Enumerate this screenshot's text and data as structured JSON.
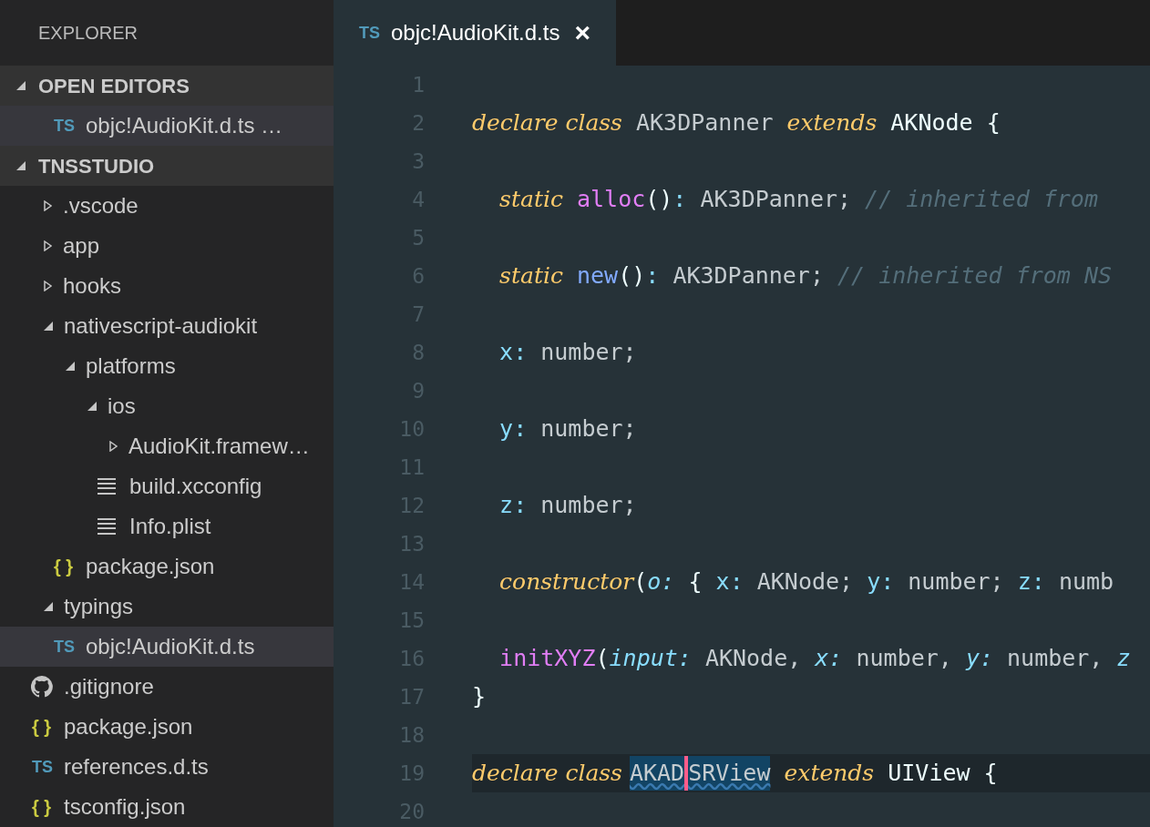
{
  "sidebar": {
    "title": "EXPLORER",
    "sections": [
      {
        "label": "OPEN EDITORS",
        "expanded": true,
        "items": [
          {
            "kind": "ts",
            "badge": "TS",
            "label": "objc!AudioKit.d.ts …",
            "selected": true
          }
        ]
      },
      {
        "label": "TNSSTUDIO",
        "expanded": true,
        "items": [
          {
            "kind": "folder",
            "label": ".vscode",
            "expanded": false,
            "selected": false
          },
          {
            "kind": "folder",
            "label": "app",
            "expanded": false,
            "selected": false
          },
          {
            "kind": "folder",
            "label": "hooks",
            "expanded": false,
            "selected": false
          },
          {
            "kind": "folder",
            "label": "nativescript-audiokit",
            "expanded": true,
            "selected": false,
            "children": [
              {
                "kind": "folder",
                "label": "platforms",
                "expanded": true,
                "selected": false,
                "children": [
                  {
                    "kind": "folder",
                    "label": "ios",
                    "expanded": true,
                    "selected": false,
                    "children": [
                      {
                        "kind": "folder",
                        "label": "AudioKit.framew…",
                        "expanded": false,
                        "selected": false
                      },
                      {
                        "kind": "text",
                        "label": "build.xcconfig",
                        "selected": false
                      },
                      {
                        "kind": "text",
                        "label": "Info.plist",
                        "selected": false
                      }
                    ]
                  }
                ]
              },
              {
                "kind": "json",
                "badge": "{ }",
                "label": "package.json",
                "selected": false
              }
            ]
          },
          {
            "kind": "folder",
            "label": "typings",
            "expanded": true,
            "selected": false,
            "children": [
              {
                "kind": "ts",
                "badge": "TS",
                "label": "objc!AudioKit.d.ts",
                "selected": true
              }
            ]
          },
          {
            "kind": "github",
            "label": ".gitignore",
            "selected": false
          },
          {
            "kind": "json",
            "badge": "{ }",
            "label": "package.json",
            "selected": false
          },
          {
            "kind": "ts",
            "badge": "TS",
            "label": "references.d.ts",
            "selected": false
          },
          {
            "kind": "json",
            "badge": "{ }",
            "label": "tsconfig.json",
            "selected": false
          }
        ]
      }
    ]
  },
  "tabs": [
    {
      "badge": "TS",
      "label": "objc!AudioKit.d.ts",
      "close": "×",
      "selected": true
    }
  ],
  "editor": {
    "lines": [
      {
        "n": "1"
      },
      {
        "n": "2",
        "tokens": [
          {
            "t": "declare class",
            "kind": "keyword"
          },
          {
            "t": " AK3DPanner ",
            "kind": "type"
          },
          {
            "t": "extends",
            "kind": "keyword"
          },
          {
            "t": " AKNode {",
            "kind": "plain"
          }
        ]
      },
      {
        "n": "3"
      },
      {
        "n": "4",
        "tokens": [
          {
            "t": "  static",
            "kind": "keyword"
          },
          {
            "t": " alloc",
            "kind": "method"
          },
          {
            "t": "()",
            "kind": "plain"
          },
          {
            "t": ":",
            "kind": "prop"
          },
          {
            "t": " AK3DPanner; ",
            "kind": "type"
          },
          {
            "t": "// inherited from",
            "kind": "comment"
          }
        ]
      },
      {
        "n": "5"
      },
      {
        "n": "6",
        "tokens": [
          {
            "t": "  static",
            "kind": "keyword"
          },
          {
            "t": " new",
            "kind": "ctor"
          },
          {
            "t": "()",
            "kind": "plain"
          },
          {
            "t": ":",
            "kind": "prop"
          },
          {
            "t": " AK3DPanner; ",
            "kind": "type"
          },
          {
            "t": "// inherited from NS",
            "kind": "comment"
          }
        ]
      },
      {
        "n": "7"
      },
      {
        "n": "8",
        "tokens": [
          {
            "t": "  x:",
            "kind": "prop"
          },
          {
            "t": " number;",
            "kind": "type"
          }
        ]
      },
      {
        "n": "9"
      },
      {
        "n": "10",
        "tokens": [
          {
            "t": "  y:",
            "kind": "prop"
          },
          {
            "t": " number;",
            "kind": "type"
          }
        ]
      },
      {
        "n": "11"
      },
      {
        "n": "12",
        "tokens": [
          {
            "t": "  z:",
            "kind": "prop"
          },
          {
            "t": " number;",
            "kind": "type"
          }
        ]
      },
      {
        "n": "13"
      },
      {
        "n": "14",
        "tokens": [
          {
            "t": "  constructor",
            "kind": "keyword"
          },
          {
            "t": "(",
            "kind": "plain"
          },
          {
            "t": "o:",
            "kind": "param"
          },
          {
            "t": " { ",
            "kind": "plain"
          },
          {
            "t": "x:",
            "kind": "prop"
          },
          {
            "t": " AKNode; ",
            "kind": "type"
          },
          {
            "t": "y:",
            "kind": "prop"
          },
          {
            "t": " number; ",
            "kind": "type"
          },
          {
            "t": "z:",
            "kind": "prop"
          },
          {
            "t": " numb",
            "kind": "type"
          }
        ]
      },
      {
        "n": "15"
      },
      {
        "n": "16",
        "tokens": [
          {
            "t": "  initXYZ",
            "kind": "method"
          },
          {
            "t": "(",
            "kind": "plain"
          },
          {
            "t": "input:",
            "kind": "param"
          },
          {
            "t": " AKNode, ",
            "kind": "type"
          },
          {
            "t": "x:",
            "kind": "param"
          },
          {
            "t": " number, ",
            "kind": "type"
          },
          {
            "t": "y:",
            "kind": "param"
          },
          {
            "t": " number, ",
            "kind": "type"
          },
          {
            "t": "z",
            "kind": "param"
          }
        ]
      },
      {
        "n": "17",
        "tokens": [
          {
            "t": "}",
            "kind": "plain"
          }
        ]
      },
      {
        "n": "18"
      },
      {
        "n": "19",
        "current": true,
        "tokens": [
          {
            "t": "declare class ",
            "kind": "keyword"
          },
          {
            "t": "AKAD",
            "kind": "type",
            "highlight": true
          },
          {
            "kind": "cursor"
          },
          {
            "t": "SRView",
            "kind": "type",
            "highlight": true
          },
          {
            "t": " extends",
            "kind": "keyword"
          },
          {
            "t": " UIView {",
            "kind": "plain"
          }
        ]
      },
      {
        "n": "20"
      }
    ]
  }
}
